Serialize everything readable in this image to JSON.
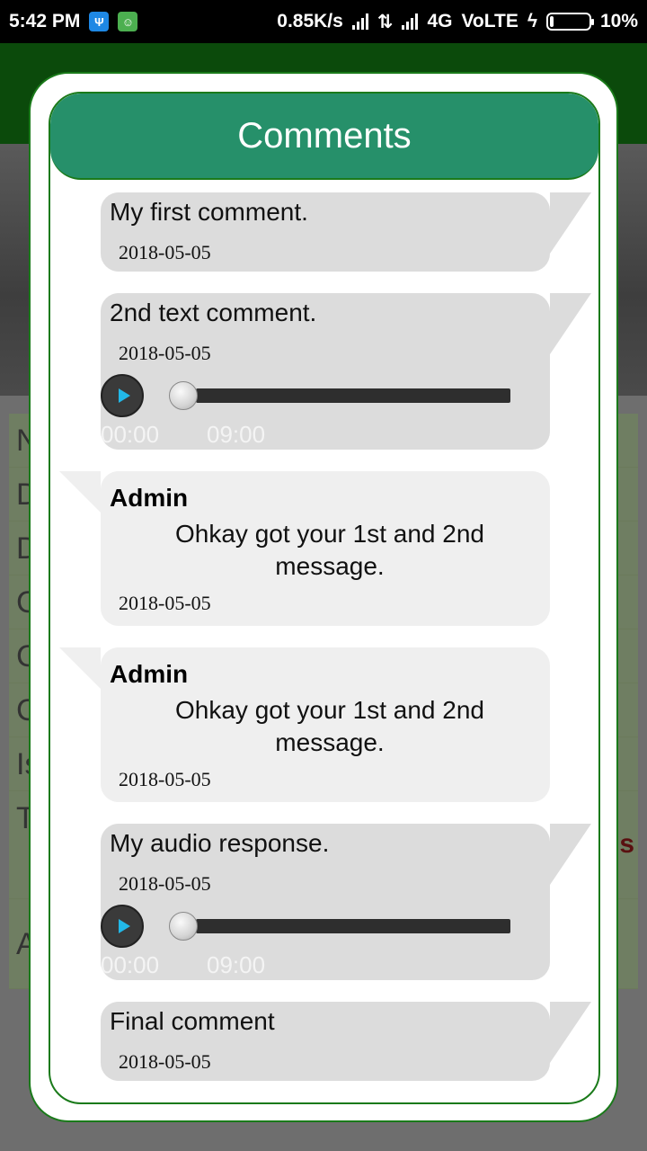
{
  "status_bar": {
    "time": "5:42 PM",
    "speed": "0.85K/s",
    "network": "4G",
    "volte": "VoLTE",
    "battery": "10%",
    "battery_level": 0.1,
    "icons": [
      "usb-icon",
      "android-icon",
      "signal-icon",
      "data-arrows-icon",
      "signal-icon",
      "charging-icon",
      "battery-icon"
    ]
  },
  "background": {
    "row_letters": [
      "N",
      "D",
      "D",
      "C",
      "C",
      "C",
      "Is",
      "T",
      "A"
    ],
    "accent_fragment": "s"
  },
  "dialog": {
    "title": "Comments",
    "accent_color": "#26906a",
    "border_color": "#1a7a1a"
  },
  "comments": [
    {
      "type": "user",
      "text": "My first comment.",
      "date": "2018-05-05"
    },
    {
      "type": "user",
      "text": "2nd text comment.",
      "date": "2018-05-05",
      "audio": {
        "current": "00:00",
        "duration": "09:00",
        "progress": 0
      }
    },
    {
      "type": "admin",
      "author": "Admin",
      "text": "Ohkay got your 1st and 2nd message.",
      "date": "2018-05-05"
    },
    {
      "type": "admin",
      "author": "Admin",
      "text": "Ohkay got your 1st and 2nd message.",
      "date": "2018-05-05"
    },
    {
      "type": "user",
      "text": "My audio response.",
      "date": "2018-05-05",
      "audio": {
        "current": "00:00",
        "duration": "09:00",
        "progress": 0
      }
    },
    {
      "type": "user",
      "text": "Final comment",
      "date": "2018-05-05"
    }
  ]
}
